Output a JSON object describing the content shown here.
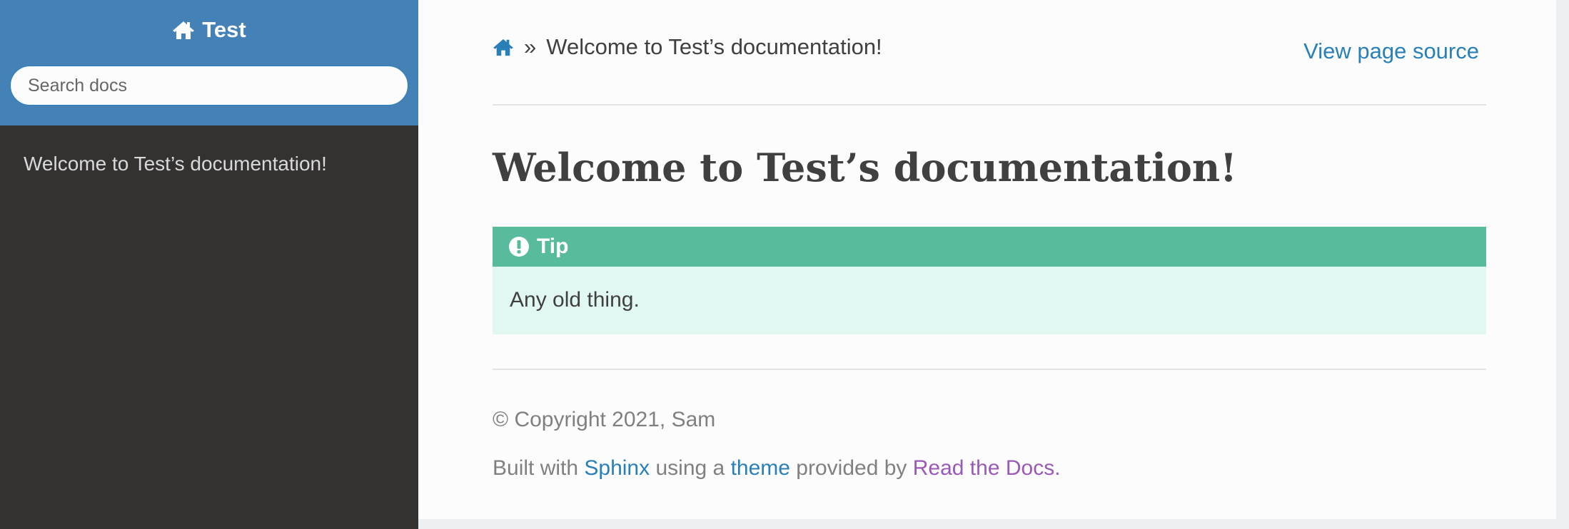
{
  "sidebar": {
    "project_name": "Test",
    "search_placeholder": "Search docs",
    "nav_items": [
      {
        "label": "Welcome to Test’s documentation!"
      }
    ]
  },
  "breadcrumbs": {
    "separator": "»",
    "current": "Welcome to Test’s documentation!",
    "view_source": "View page source"
  },
  "page": {
    "title": "Welcome to Test’s documentation!",
    "admonition": {
      "title": "Tip",
      "body": "Any old thing."
    }
  },
  "footer": {
    "copyright": "© Copyright 2021, Sam",
    "built_prefix": "Built with",
    "sphinx_link": "Sphinx",
    "using_a": "using a",
    "theme_link": "theme",
    "provided_by": "provided by",
    "rtd_link": "Read the Docs",
    "period": "."
  },
  "colors": {
    "sidebar_header": "#4381b6",
    "sidebar_bg": "#343131",
    "link": "#2980b9",
    "visited_link": "#9b59b6",
    "tip_title_bg": "#59bb9e",
    "tip_body_bg": "#e0f7f2"
  },
  "icons": {
    "project": "home-icon",
    "breadcrumb_home": "home-icon",
    "admonition": "exclamation-circle-icon"
  }
}
